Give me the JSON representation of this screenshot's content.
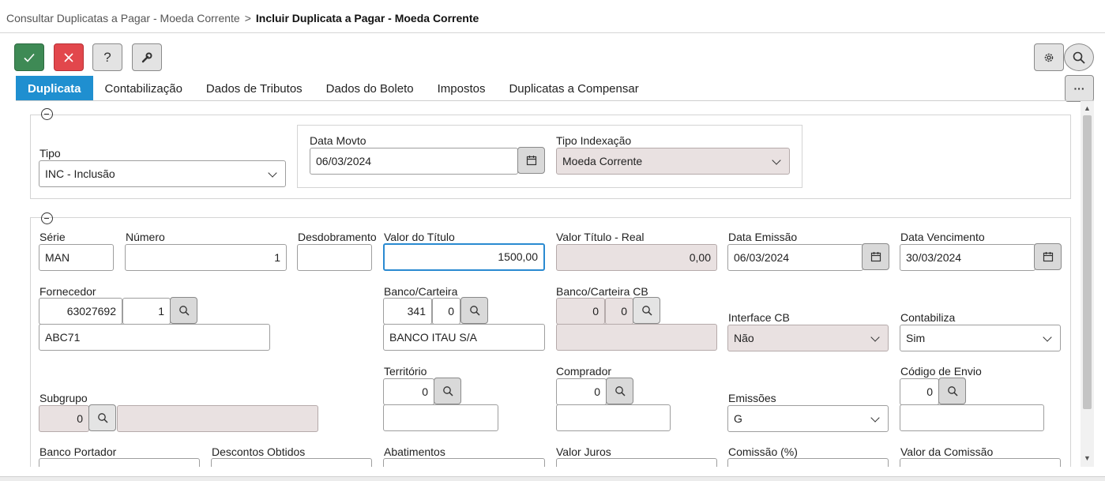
{
  "breadcrumb": {
    "previous": "Consultar Duplicatas a Pagar - Moeda Corrente",
    "separator": ">",
    "current": "Incluir Duplicata a Pagar - Moeda Corrente"
  },
  "toolbar": {
    "confirm_icon": "check-icon",
    "cancel_icon": "close-icon",
    "help_label": "?",
    "tools_icon": "wrench-icon",
    "settings_icon": "gear-icon",
    "search_icon": "search-icon",
    "more_label": "···"
  },
  "tabs": [
    {
      "label": "Duplicata",
      "active": true
    },
    {
      "label": "Contabilização"
    },
    {
      "label": "Dados de Tributos"
    },
    {
      "label": "Dados do Boleto"
    },
    {
      "label": "Impostos"
    },
    {
      "label": "Duplicatas a Compensar"
    }
  ],
  "section1": {
    "tipo": {
      "label": "Tipo",
      "value": "INC - Inclusão"
    },
    "data_movto": {
      "label": "Data Movto",
      "value": "06/03/2024"
    },
    "tipo_indexacao": {
      "label": "Tipo Indexação",
      "value": "Moeda Corrente"
    }
  },
  "section2": {
    "serie": {
      "label": "Série",
      "value": "MAN"
    },
    "numero": {
      "label": "Número",
      "value": "1"
    },
    "desdobramento": {
      "label": "Desdobramento",
      "value": ""
    },
    "valor_titulo": {
      "label": "Valor do Título",
      "value": "1500,00"
    },
    "valor_titulo_real": {
      "label": "Valor Título - Real",
      "value": "0,00"
    },
    "data_emissao": {
      "label": "Data Emissão",
      "value": "06/03/2024"
    },
    "data_vencimento": {
      "label": "Data Vencimento",
      "value": "30/03/2024"
    },
    "fornecedor": {
      "label": "Fornecedor",
      "code": "63027692",
      "sub": "1",
      "name": "ABC71"
    },
    "banco_carteira": {
      "label": "Banco/Carteira",
      "code": "341",
      "sub": "0",
      "name": "BANCO ITAU S/A"
    },
    "banco_carteira_cb": {
      "label": "Banco/Carteira CB",
      "code": "0",
      "sub": "0",
      "name": ""
    },
    "interface_cb": {
      "label": "Interface CB",
      "value": "Não"
    },
    "contabiliza": {
      "label": "Contabiliza",
      "value": "Sim"
    },
    "territorio": {
      "label": "Território",
      "code": "0",
      "name": ""
    },
    "comprador": {
      "label": "Comprador",
      "code": "0",
      "name": ""
    },
    "codigo_envio": {
      "label": "Código de Envio",
      "code": "0",
      "name": ""
    },
    "subgrupo": {
      "label": "Subgrupo",
      "code": "0",
      "name": ""
    },
    "emissoes": {
      "label": "Emissões",
      "value": "G"
    },
    "banco_portador": {
      "label": "Banco Portador"
    },
    "descontos_obtidos": {
      "label": "Descontos Obtidos"
    },
    "abatimentos": {
      "label": "Abatimentos"
    },
    "valor_juros": {
      "label": "Valor Juros"
    },
    "comissao_pct": {
      "label": "Comissão (%)"
    },
    "valor_comissao": {
      "label": "Valor da Comissão"
    }
  },
  "colors": {
    "confirm": "#3e8a55",
    "cancel": "#e2474c",
    "active_tab": "#1f8fd0",
    "readonly_field": "#e9e1e1",
    "focus_border": "#2a8ad1"
  }
}
